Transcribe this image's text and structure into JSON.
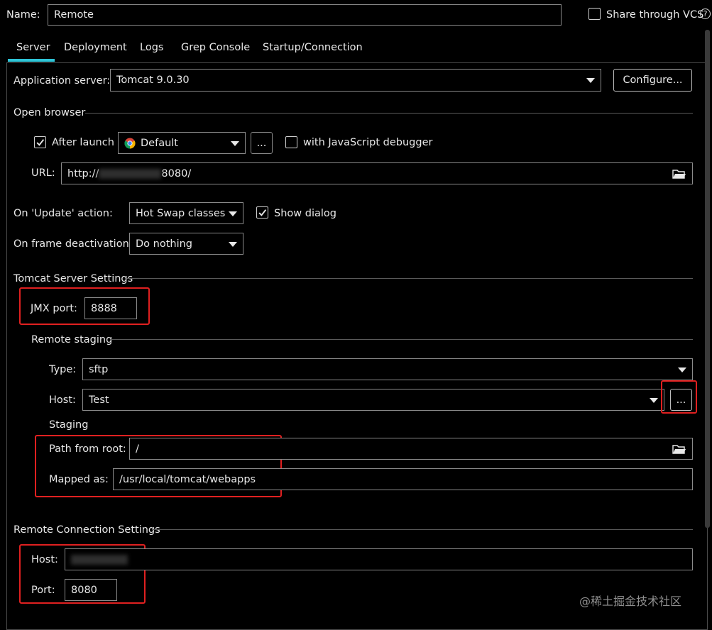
{
  "header": {
    "name_label": "Name:",
    "name_value": "Remote",
    "share_vcs_label": "Share through VCS",
    "share_vcs_checked": false,
    "help_glyph": "?"
  },
  "tabs": [
    {
      "label": "Server",
      "active": true
    },
    {
      "label": "Deployment",
      "active": false
    },
    {
      "label": "Logs",
      "active": false
    },
    {
      "label": "Grep Console",
      "active": false
    },
    {
      "label": "Startup/Connection",
      "active": false
    }
  ],
  "server": {
    "app_server_label": "Application server:",
    "app_server_value": "Tomcat 9.0.30",
    "configure_label": "Configure..."
  },
  "open_browser": {
    "section_title": "Open browser",
    "after_launch_label": "After launch",
    "after_launch_checked": true,
    "browser_value": "Default",
    "browse_button": "...",
    "js_debugger_label": "with JavaScript debugger",
    "js_debugger_checked": false,
    "url_label": "URL:",
    "url_prefix": "http://",
    "url_suffix": "8080/"
  },
  "actions": {
    "update_label": "On 'Update' action:",
    "update_value": "Hot Swap classes",
    "show_dialog_label": "Show dialog",
    "show_dialog_checked": true,
    "frame_deactivation_label": "On frame deactivation:",
    "frame_deactivation_value": "Do nothing"
  },
  "tomcat": {
    "section_title": "Tomcat Server Settings",
    "jmx_label": "JMX port:",
    "jmx_value": "8888"
  },
  "remote_staging": {
    "section_title": "Remote staging",
    "type_label": "Type:",
    "type_value": "sftp",
    "host_label": "Host:",
    "host_value": "Test",
    "host_button": "...",
    "staging_label": "Staging",
    "path_label": "Path from root:",
    "path_value": "/",
    "mapped_label": "Mapped as:",
    "mapped_value": "/usr/local/tomcat/webapps"
  },
  "remote_connection": {
    "section_title": "Remote Connection Settings",
    "host_label": "Host:",
    "host_value": "",
    "port_label": "Port:",
    "port_value": "8080"
  },
  "watermark": "@稀土掘金技术社区",
  "colors": {
    "background": "#000000",
    "accent_tab": "#2fc4d6",
    "highlight_red": "#e02020",
    "border": "#8a8a8a"
  },
  "icons": [
    "checkbox-check-icon",
    "dropdown-caret-icon",
    "folder-icon",
    "chrome-icon",
    "help-icon"
  ]
}
